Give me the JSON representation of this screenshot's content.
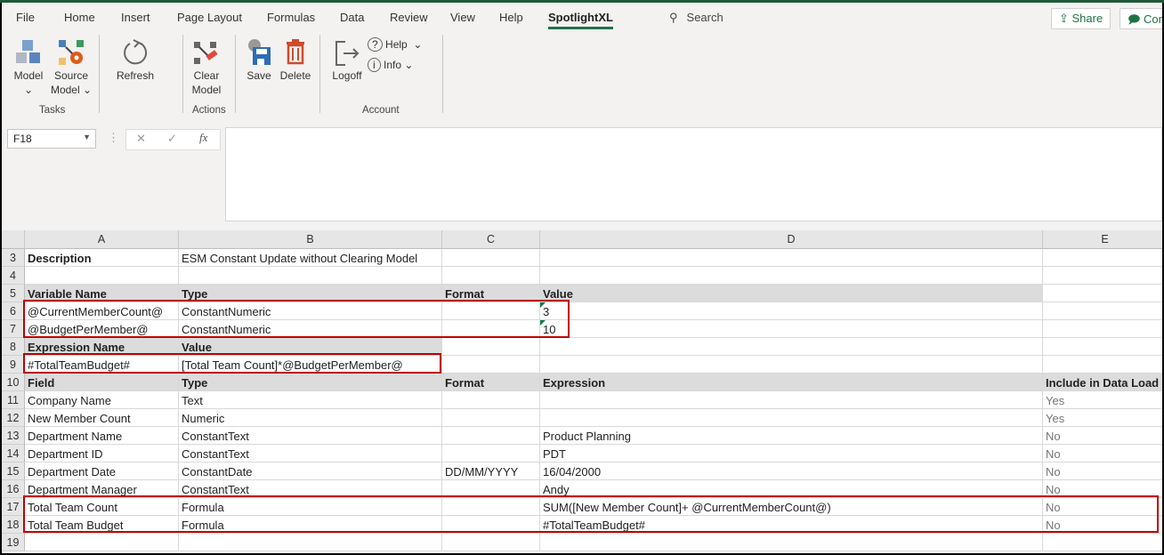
{
  "ribbon": {
    "tabs": [
      "File",
      "Home",
      "Insert",
      "Page Layout",
      "Formulas",
      "Data",
      "Review",
      "View",
      "Help",
      "SpotlightXL"
    ],
    "active_tab": "SpotlightXL",
    "search": "Search",
    "share": "Share",
    "comments": "Comments",
    "buttons": {
      "model": "Model",
      "source_model_1": "Source",
      "source_model_2": "Model",
      "refresh": "Refresh",
      "clear_1": "Clear",
      "clear_2": "Model",
      "save": "Save",
      "delete": "Delete",
      "logoff": "Logoff",
      "help": "Help",
      "info": "Info"
    },
    "groups": {
      "tasks": "Tasks",
      "actions": "Actions",
      "account": "Account"
    }
  },
  "formula_bar": {
    "name_box": "F18",
    "fx": "fx",
    "cancel": "✕",
    "enter": "✓",
    "value": ""
  },
  "columns": [
    "A",
    "B",
    "C",
    "D",
    "E"
  ],
  "rows": [
    {
      "n": "3",
      "cells": [
        "Description",
        "ESM Constant Update without Clearing Model",
        "",
        "",
        ""
      ]
    },
    {
      "n": "4",
      "cells": [
        "",
        "",
        "",
        "",
        ""
      ]
    },
    {
      "n": "5",
      "cells": [
        "Variable Name",
        "Type",
        "Format",
        "Value",
        ""
      ]
    },
    {
      "n": "6",
      "cells": [
        "@CurrentMemberCount@",
        "ConstantNumeric",
        "",
        "3",
        ""
      ]
    },
    {
      "n": "7",
      "cells": [
        "@BudgetPerMember@",
        "ConstantNumeric",
        "",
        "10",
        ""
      ]
    },
    {
      "n": "8",
      "cells": [
        "Expression Name",
        "Value",
        "",
        "",
        ""
      ]
    },
    {
      "n": "9",
      "cells": [
        "#TotalTeamBudget#",
        "[Total Team Count]*@BudgetPerMember@",
        "",
        "",
        ""
      ]
    },
    {
      "n": "10",
      "cells": [
        "Field",
        "Type",
        "Format",
        "Expression",
        "Include in Data Load"
      ]
    },
    {
      "n": "11",
      "cells": [
        "Company Name",
        "Text",
        "",
        "",
        "Yes"
      ]
    },
    {
      "n": "12",
      "cells": [
        "New Member Count",
        "Numeric",
        "",
        "",
        "Yes"
      ]
    },
    {
      "n": "13",
      "cells": [
        "Department Name",
        "ConstantText",
        "",
        "Product Planning",
        "No"
      ]
    },
    {
      "n": "14",
      "cells": [
        "Department ID",
        "ConstantText",
        "",
        "PDT",
        "No"
      ]
    },
    {
      "n": "15",
      "cells": [
        "Department Date",
        "ConstantDate",
        "DD/MM/YYYY",
        "16/04/2000",
        "No"
      ]
    },
    {
      "n": "16",
      "cells": [
        "Department Manager",
        "ConstantText",
        "",
        "Andy",
        "No"
      ]
    },
    {
      "n": "17",
      "cells": [
        "Total Team Count",
        "Formula",
        "",
        "SUM([New Member Count]+ @CurrentMemberCount@)",
        "No"
      ]
    },
    {
      "n": "18",
      "cells": [
        "Total Team Budget",
        "Formula",
        "",
        "#TotalTeamBudget#",
        "No"
      ]
    },
    {
      "n": "19",
      "cells": [
        "",
        "",
        "",
        "",
        ""
      ]
    }
  ],
  "colors": {
    "accent": "#217346",
    "highlight_box": "#c00000",
    "header_fill": "#dcdcdc"
  }
}
